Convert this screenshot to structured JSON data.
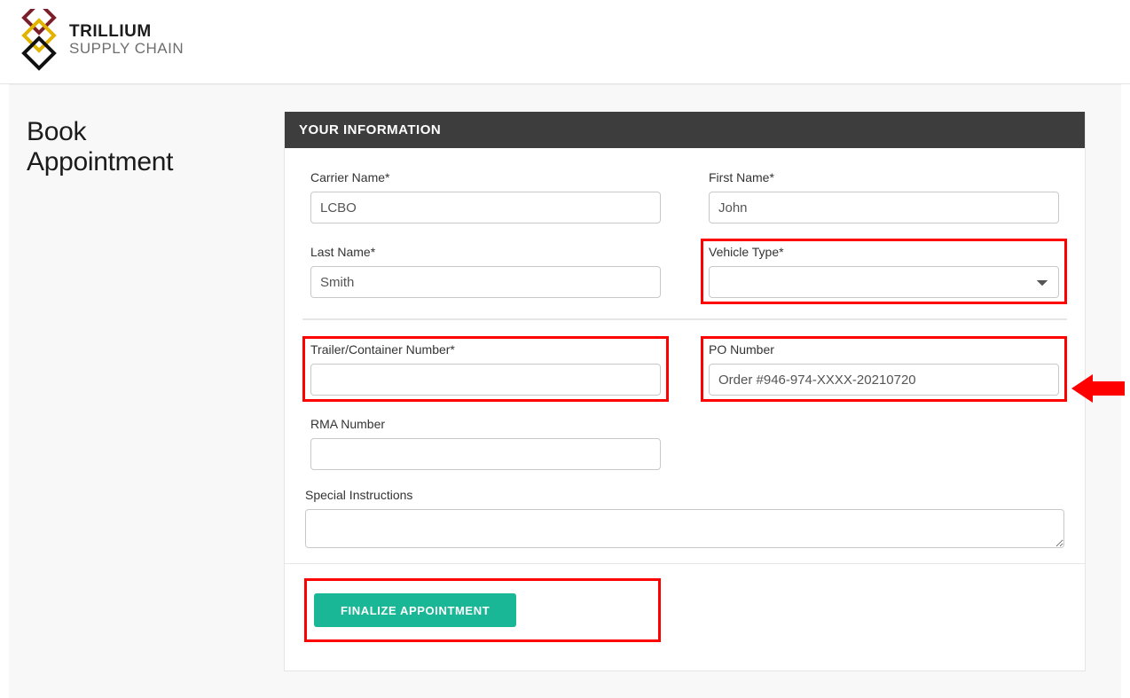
{
  "brand": {
    "line1": "TRILLIUM",
    "line2": "SUPPLY CHAIN"
  },
  "page": {
    "title": "Book\nAppointment"
  },
  "section": {
    "header": "YOUR INFORMATION"
  },
  "fields": {
    "carrier_name": {
      "label": "Carrier Name*",
      "value": "LCBO"
    },
    "first_name": {
      "label": "First Name*",
      "value": "John"
    },
    "last_name": {
      "label": "Last Name*",
      "value": "Smith"
    },
    "vehicle_type": {
      "label": "Vehicle Type*",
      "value": ""
    },
    "trailer_number": {
      "label": "Trailer/Container Number*",
      "value": ""
    },
    "po_number": {
      "label": "PO Number",
      "value": "Order #946-974-XXXX-20210720"
    },
    "rma_number": {
      "label": "RMA Number",
      "value": ""
    },
    "special_instructions": {
      "label": "Special Instructions",
      "value": ""
    }
  },
  "buttons": {
    "finalize": "FINALIZE APPOINTMENT"
  }
}
